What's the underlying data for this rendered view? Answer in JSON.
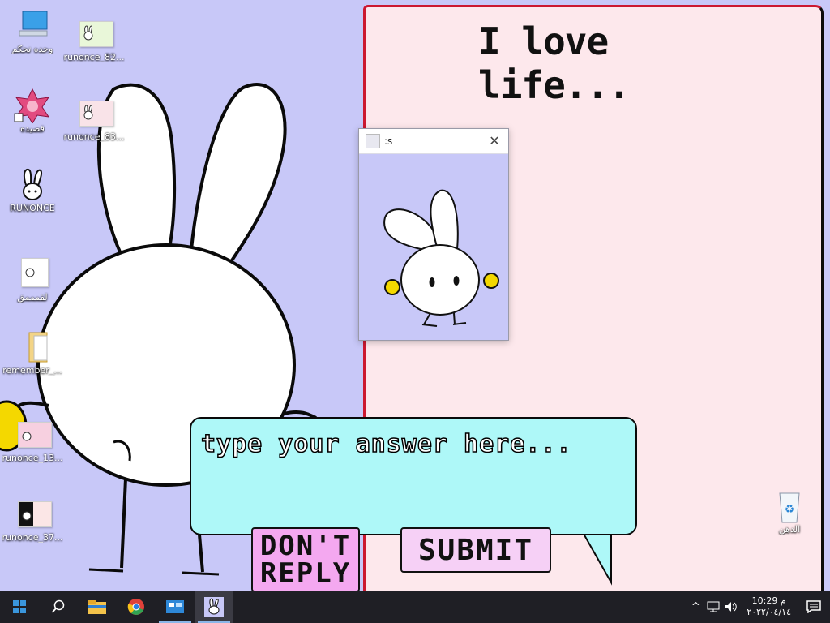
{
  "desktop": {
    "icons": [
      {
        "label": "ﻭﺣﺪﻩ ﺗﺤﻜﻢ",
        "icon": "control-panel-icon"
      },
      {
        "label": "runonce_82...",
        "icon": "image-file-icon"
      },
      {
        "label": "ﻗﺼﻴﺪﻩ",
        "icon": "mandala-shortcut-icon"
      },
      {
        "label": "runonce_83...",
        "icon": "image-file-icon"
      },
      {
        "label": "RUNONCE",
        "icon": "bunny-app-icon"
      },
      {
        "label": "ﻟﻘﻤﻤﻤﻖ",
        "icon": "document-icon"
      },
      {
        "label": "remember_...",
        "icon": "folder-icon"
      },
      {
        "label": "runonce_13...",
        "icon": "image-file-icon"
      },
      {
        "label": "runonce_37...",
        "icon": "image-file-icon"
      },
      {
        "label": "ﺍﻟﺪﻫﻦ",
        "icon": "recycle-bin-icon"
      }
    ]
  },
  "paper": {
    "title": "I love life..."
  },
  "mini_window": {
    "title": ":s"
  },
  "dialog": {
    "placeholder": "type your answer here...",
    "dont_reply_label": "DON'T REPLY",
    "submit_label": "SUBMIT"
  },
  "taskbar": {
    "items": [
      "start-icon",
      "search-icon",
      "file-explorer-icon",
      "chrome-icon",
      "control-panel-icon",
      "bunny-app-icon"
    ],
    "clock_time": "10:29 م",
    "clock_date": "٢٠٢٢/٠٤/١٤"
  },
  "colors": {
    "desktop_bg": "#c8c8f8",
    "paper_bg": "#fde8ec",
    "bubble_bg": "#aef8f8",
    "dont_reply_bg": "#f4a8f0",
    "submit_bg": "#f6d0f6",
    "taskbar_bg": "#1f1f25"
  }
}
